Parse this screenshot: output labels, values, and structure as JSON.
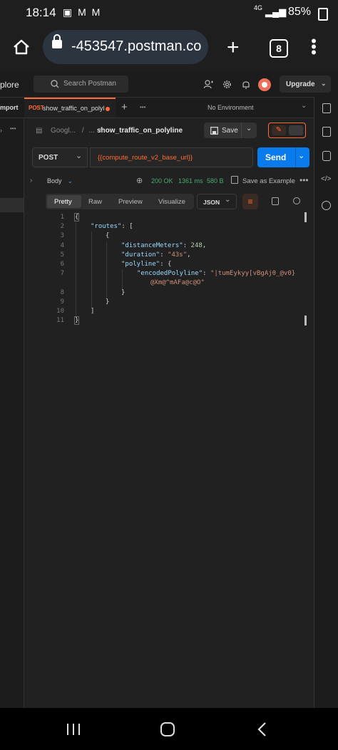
{
  "status_bar": {
    "time": "18:14",
    "notif_icons": "▣ M M",
    "network": "4G",
    "battery": "85%"
  },
  "browser": {
    "url": "-453547.postman.co",
    "tab_count": "8"
  },
  "header": {
    "explore": "plore",
    "search_placeholder": "Search Postman",
    "upgrade": "Upgrade"
  },
  "tabs": {
    "import": "mport",
    "active_method": "POST",
    "active_name": "show_traffic_on_polyl",
    "new_tab": "+",
    "more": "•••",
    "environment": "No Environment"
  },
  "breadcrumb": {
    "collection": "Googl...",
    "sep1": "/",
    "ellipsis": "...",
    "sep2": "/",
    "request_name": "show_traffic_on_polyline",
    "save": "Save"
  },
  "request": {
    "method": "POST",
    "url": "{{compute_route_v2_base_url}}",
    "send": "Send"
  },
  "response": {
    "section": "Body",
    "status": "200 OK",
    "time": "1361 ms",
    "size": "580 B",
    "save_example": "Save as Example",
    "view_tabs": [
      "Pretty",
      "Raw",
      "Preview",
      "Visualize"
    ],
    "format": "JSON",
    "lines": [
      {
        "num": "1",
        "text": "{"
      },
      {
        "num": "2",
        "key": "\"routes\"",
        "rest": ": ["
      },
      {
        "num": "3",
        "text": "{"
      },
      {
        "num": "4",
        "key": "\"distanceMeters\"",
        "rest": ": ",
        "val": "248",
        "end": ","
      },
      {
        "num": "5",
        "key": "\"duration\"",
        "rest": ": ",
        "val": "\"43s\"",
        "end": ","
      },
      {
        "num": "6",
        "key": "\"polyline\"",
        "rest": ": {"
      },
      {
        "num": "7",
        "key": "\"encodedPolyline\"",
        "rest": ": ",
        "val": "\"|tumEykyy[vBgAj0_@v0}",
        "val2": "@Xm@^mAFa@c@O\""
      },
      {
        "num": "8",
        "text": "}"
      },
      {
        "num": "9",
        "text": "}"
      },
      {
        "num": "10",
        "text": "]"
      },
      {
        "num": "11",
        "text": "}"
      }
    ]
  }
}
